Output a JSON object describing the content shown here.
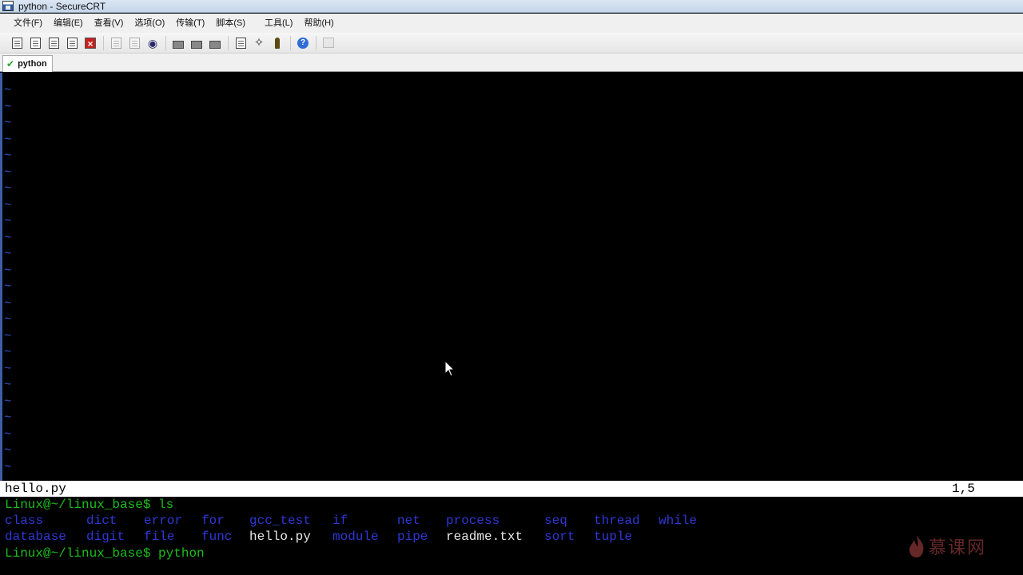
{
  "window": {
    "title": "python - SecureCRT"
  },
  "menu": {
    "items": [
      "文件(F)",
      "编辑(E)",
      "查看(V)",
      "选项(O)",
      "传输(T)",
      "脚本(S)",
      "工具(L)",
      "帮助(H)"
    ]
  },
  "toolbar": {
    "icons": [
      "connect-icon",
      "quick-connect-icon",
      "connect-tab-icon",
      "reconnect-icon",
      "disconnect-icon",
      "copy-icon",
      "paste-icon",
      "find-icon",
      "print-icon",
      "print-selection-icon",
      "print-setup-icon",
      "session-options-icon",
      "global-options-icon",
      "keymap-icon",
      "help-icon",
      "window-icon"
    ]
  },
  "tabs": [
    {
      "label": "python",
      "status": "connected"
    }
  ],
  "terminal": {
    "tilde_char": "~",
    "status_filename": "hello.py",
    "status_position": "1,5",
    "prompt1": "Linux@~/linux_base$ ls",
    "ls_row1": [
      "class",
      "dict",
      "error",
      "for",
      "gcc_test",
      "if",
      "net",
      "process",
      "seq",
      "thread",
      "while"
    ],
    "ls_row2": [
      "database",
      "digit",
      "file",
      "func",
      "hello.py",
      "module",
      "pipe",
      "readme.txt",
      "sort",
      "tuple"
    ],
    "prompt2": "Linux@~/linux_base$ python",
    "colors": {
      "prompt": "#1bbd1b",
      "directory": "#2e38d6",
      "file": "#e8e8e8",
      "tilde": "#2e4ebf"
    }
  },
  "watermark": {
    "text": "慕课网"
  }
}
